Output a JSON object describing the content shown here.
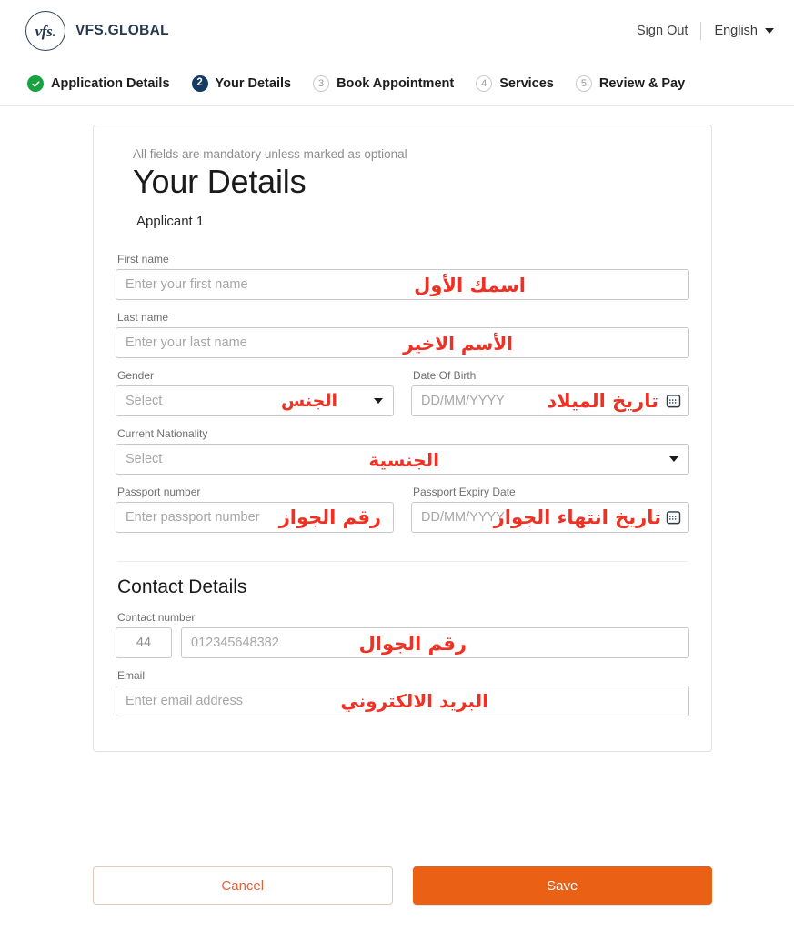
{
  "header": {
    "brand_mark": "vfs.",
    "brand_name": "VFS.GLOBAL",
    "sign_out": "Sign Out",
    "language": "English"
  },
  "stepper": {
    "steps": [
      {
        "number": "1",
        "label": "Application Details",
        "state": "done"
      },
      {
        "number": "2",
        "label": "Your Details",
        "state": "active"
      },
      {
        "number": "3",
        "label": "Book Appointment",
        "state": "todo"
      },
      {
        "number": "4",
        "label": "Services",
        "state": "todo"
      },
      {
        "number": "5",
        "label": "Review & Pay",
        "state": "todo"
      }
    ]
  },
  "form": {
    "mandatory_note": "All fields are mandatory unless marked as optional",
    "title": "Your Details",
    "applicant": "Applicant 1",
    "first_name": {
      "label": "First name",
      "placeholder": "Enter your first name",
      "value": "",
      "annotation": "اسمك الأول"
    },
    "last_name": {
      "label": "Last name",
      "placeholder": "Enter your last name",
      "value": "",
      "annotation": "الأسم الاخير"
    },
    "gender": {
      "label": "Gender",
      "placeholder": "Select",
      "value": "",
      "annotation": "الجنس"
    },
    "date_of_birth": {
      "label": "Date Of Birth",
      "placeholder": "DD/MM/YYYY",
      "value": "",
      "annotation": "تاريخ الميلاد",
      "icon": "calendar-icon"
    },
    "nationality": {
      "label": "Current Nationality",
      "placeholder": "Select",
      "value": "",
      "annotation": "الجنسية"
    },
    "passport_number": {
      "label": "Passport number",
      "placeholder": "Enter passport number",
      "value": "",
      "annotation": "رقم الجواز"
    },
    "passport_expiry": {
      "label": "Passport Expiry Date",
      "placeholder": "DD/MM/YYYY",
      "value": "",
      "annotation": "تاريخ انتهاء الجواز",
      "icon": "calendar-icon"
    },
    "contact_section_title": "Contact Details",
    "contact_number": {
      "label": "Contact number",
      "country_code": "44",
      "placeholder": "012345648382",
      "value": "",
      "annotation": "رقم الجوال"
    },
    "email": {
      "label": "Email",
      "placeholder": "Enter email address",
      "value": "",
      "annotation": "البريد الالكتروني"
    }
  },
  "actions": {
    "cancel": "Cancel",
    "save": "Save"
  },
  "colors": {
    "brand_navy": "#24384f",
    "step_done_green": "#15a33f",
    "step_active_navy": "#123a63",
    "annotation_red": "#ee3124",
    "save_orange": "#ea6014",
    "cancel_text": "#e2623a"
  }
}
